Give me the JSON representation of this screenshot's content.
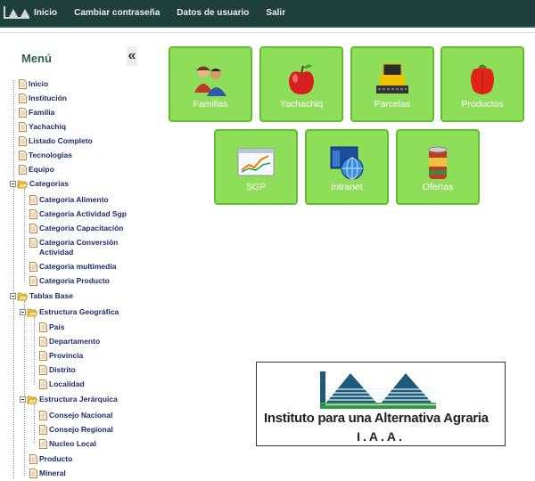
{
  "nav": {
    "items": [
      "Inicio",
      "Cambiar contraseña",
      "Datos de usuario",
      "Salir"
    ]
  },
  "sidebar": {
    "title": "Menú",
    "collapse_glyph": "«",
    "tree": [
      {
        "label": "Inicio",
        "type": "file"
      },
      {
        "label": "Institución",
        "type": "file"
      },
      {
        "label": "Familia",
        "type": "file"
      },
      {
        "label": "Yachachiq",
        "type": "file"
      },
      {
        "label": "Listado Completo",
        "type": "file"
      },
      {
        "label": "Tecnologias",
        "type": "file"
      },
      {
        "label": "Equipo",
        "type": "file"
      },
      {
        "label": "Categorias",
        "type": "folder"
      },
      {
        "label": "Categoria Alimento",
        "type": "file"
      },
      {
        "label": "Categoria Actividad Sgp",
        "type": "file"
      },
      {
        "label": "Categoria Capacitación",
        "type": "file"
      },
      {
        "label": "Categoria Conversión",
        "type": "file"
      },
      {
        "label": "Actividad",
        "type": "cont"
      },
      {
        "label": "Categoria multimedia",
        "type": "file"
      },
      {
        "label": "Categoria Producto",
        "type": "file"
      },
      {
        "label": "Tablas Base",
        "type": "folder"
      },
      {
        "label": "Estructura Geográfica",
        "type": "folder"
      },
      {
        "label": "Pais",
        "type": "file"
      },
      {
        "label": "Departamento",
        "type": "file"
      },
      {
        "label": "Provincia",
        "type": "file"
      },
      {
        "label": "Distrito",
        "type": "file"
      },
      {
        "label": "Localidad",
        "type": "file"
      },
      {
        "label": "Estructura Jerárquica",
        "type": "folder"
      },
      {
        "label": "Consejo Nacional",
        "type": "file"
      },
      {
        "label": "Consejo Regional",
        "type": "file"
      },
      {
        "label": "Nucleo Local",
        "type": "file"
      },
      {
        "label": "Producto",
        "type": "file"
      },
      {
        "label": "Mineral",
        "type": "file"
      }
    ]
  },
  "tiles": [
    {
      "label": "Familias",
      "icon": "family-icon"
    },
    {
      "label": "Yachachiq",
      "icon": "apple-icon"
    },
    {
      "label": "Parcelas",
      "icon": "tractor-icon"
    },
    {
      "label": "Productos",
      "icon": "pepper-icon"
    },
    {
      "label": "SGP",
      "icon": "chart-window-icon"
    },
    {
      "label": "Intranet",
      "icon": "globe-icon"
    },
    {
      "label": "Ofertas",
      "icon": "can-icon"
    }
  ],
  "logo": {
    "title": "Instituto para una Alternativa Agraria",
    "abbrev": "I.A.A."
  },
  "colors": {
    "topbar": "#1f3f3a",
    "tile": "#8fde5a",
    "tile_border": "#5fbf2f",
    "tree_text": "#1d2b6b"
  }
}
